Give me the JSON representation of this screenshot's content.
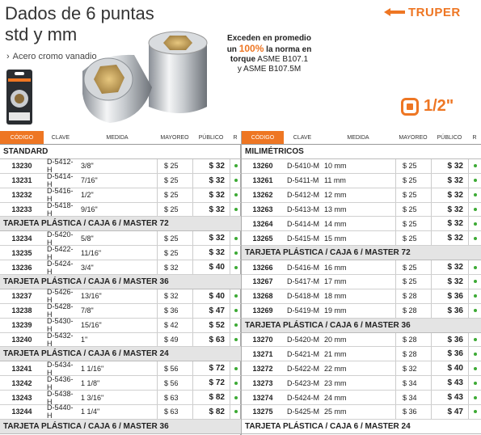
{
  "header": {
    "title": "Dados de 6 puntas std y mm",
    "subtitle": "Acero cromo vanadio",
    "brand": "TRUPER",
    "claim_line1": "Exceden en promedio",
    "claim_line2_pre": "un ",
    "claim_highlight": "100%",
    "claim_line2_post": " la norma en",
    "claim_line3_bold": "torque",
    "claim_line3_rest": " ASME B107.1",
    "claim_line4": "y ASME B107.5M",
    "drive_size": "1/2\"",
    "brand_color": "#ee7623"
  },
  "columns": [
    "CÓDIGO",
    "CLAVE",
    "MEDIDA",
    "MAYOREO",
    "PÚBLICO",
    "R"
  ],
  "left": [
    {
      "type": "section",
      "label": "STANDARD",
      "grey": false
    },
    {
      "type": "row",
      "codigo": "13230",
      "clave": "D-5412-H",
      "medida": "3/8\"",
      "mayoreo": "$ 25",
      "publico": "$ 32"
    },
    {
      "type": "row",
      "codigo": "13231",
      "clave": "D-5414-H",
      "medida": "7/16\"",
      "mayoreo": "$ 25",
      "publico": "$ 32"
    },
    {
      "type": "row",
      "codigo": "13232",
      "clave": "D-5416-H",
      "medida": "1/2\"",
      "mayoreo": "$ 25",
      "publico": "$ 32"
    },
    {
      "type": "row",
      "codigo": "13233",
      "clave": "D-5418-H",
      "medida": "9/16\"",
      "mayoreo": "$ 25",
      "publico": "$ 32"
    },
    {
      "type": "section",
      "label": "TARJETA PLÁSTICA / CAJA 6 / MASTER 72",
      "grey": true
    },
    {
      "type": "row",
      "codigo": "13234",
      "clave": "D-5420-H",
      "medida": "5/8\"",
      "mayoreo": "$ 25",
      "publico": "$ 32"
    },
    {
      "type": "row",
      "codigo": "13235",
      "clave": "D-5422-H",
      "medida": "11/16\"",
      "mayoreo": "$ 25",
      "publico": "$ 32"
    },
    {
      "type": "row",
      "codigo": "13236",
      "clave": "D-5424-H",
      "medida": "3/4\"",
      "mayoreo": "$ 32",
      "publico": "$ 40"
    },
    {
      "type": "section",
      "label": "TARJETA PLÁSTICA / CAJA 6 / MASTER 36",
      "grey": true
    },
    {
      "type": "row",
      "codigo": "13237",
      "clave": "D-5426-H",
      "medida": "13/16\"",
      "mayoreo": "$ 32",
      "publico": "$ 40"
    },
    {
      "type": "row",
      "codigo": "13238",
      "clave": "D-5428-H",
      "medida": "7/8\"",
      "mayoreo": "$ 36",
      "publico": "$ 47"
    },
    {
      "type": "row",
      "codigo": "13239",
      "clave": "D-5430-H",
      "medida": "15/16\"",
      "mayoreo": "$ 42",
      "publico": "$ 52"
    },
    {
      "type": "row",
      "codigo": "13240",
      "clave": "D-5432-H",
      "medida": "1\"",
      "mayoreo": "$ 49",
      "publico": "$ 63"
    },
    {
      "type": "section",
      "label": "TARJETA PLÁSTICA / CAJA 6 / MASTER 24",
      "grey": true
    },
    {
      "type": "row",
      "codigo": "13241",
      "clave": "D-5434-H",
      "medida": "1 1/16\"",
      "mayoreo": "$ 56",
      "publico": "$ 72"
    },
    {
      "type": "row",
      "codigo": "13242",
      "clave": "D-5436-H",
      "medida": "1 1/8\"",
      "mayoreo": "$ 56",
      "publico": "$ 72"
    },
    {
      "type": "row",
      "codigo": "13243",
      "clave": "D-5438-H",
      "medida": "1 3/16\"",
      "mayoreo": "$ 63",
      "publico": "$ 82"
    },
    {
      "type": "row",
      "codigo": "13244",
      "clave": "D-5440-H",
      "medida": "1 1/4\"",
      "mayoreo": "$ 63",
      "publico": "$ 82"
    },
    {
      "type": "section",
      "label": "TARJETA PLÁSTICA / CAJA 6 / MASTER 36",
      "grey": true
    }
  ],
  "right": [
    {
      "type": "section",
      "label": "MILIMÉTRICOS",
      "grey": false
    },
    {
      "type": "row",
      "codigo": "13260",
      "clave": "D-5410-M",
      "medida": "10 mm",
      "mayoreo": "$ 25",
      "publico": "$ 32"
    },
    {
      "type": "row",
      "codigo": "13261",
      "clave": "D-5411-M",
      "medida": "11 mm",
      "mayoreo": "$ 25",
      "publico": "$ 32"
    },
    {
      "type": "row",
      "codigo": "13262",
      "clave": "D-5412-M",
      "medida": "12 mm",
      "mayoreo": "$ 25",
      "publico": "$ 32"
    },
    {
      "type": "row",
      "codigo": "13263",
      "clave": "D-5413-M",
      "medida": "13 mm",
      "mayoreo": "$ 25",
      "publico": "$ 32"
    },
    {
      "type": "row",
      "codigo": "13264",
      "clave": "D-5414-M",
      "medida": "14 mm",
      "mayoreo": "$ 25",
      "publico": "$ 32"
    },
    {
      "type": "row",
      "codigo": "13265",
      "clave": "D-5415-M",
      "medida": "15 mm",
      "mayoreo": "$ 25",
      "publico": "$ 32"
    },
    {
      "type": "section",
      "label": "TARJETA PLÁSTICA / CAJA 6 / MASTER 72",
      "grey": true
    },
    {
      "type": "row",
      "codigo": "13266",
      "clave": "D-5416-M",
      "medida": "16 mm",
      "mayoreo": "$ 25",
      "publico": "$ 32"
    },
    {
      "type": "row",
      "codigo": "13267",
      "clave": "D-5417-M",
      "medida": "17 mm",
      "mayoreo": "$ 25",
      "publico": "$ 32"
    },
    {
      "type": "row",
      "codigo": "13268",
      "clave": "D-5418-M",
      "medida": "18 mm",
      "mayoreo": "$ 28",
      "publico": "$ 36"
    },
    {
      "type": "row",
      "codigo": "13269",
      "clave": "D-5419-M",
      "medida": "19 mm",
      "mayoreo": "$ 28",
      "publico": "$ 36"
    },
    {
      "type": "section",
      "label": "TARJETA PLÁSTICA / CAJA 6 / MASTER 36",
      "grey": true
    },
    {
      "type": "row",
      "codigo": "13270",
      "clave": "D-5420-M",
      "medida": "20 mm",
      "mayoreo": "$ 28",
      "publico": "$ 36"
    },
    {
      "type": "row",
      "codigo": "13271",
      "clave": "D-5421-M",
      "medida": "21 mm",
      "mayoreo": "$ 28",
      "publico": "$ 36"
    },
    {
      "type": "row",
      "codigo": "13272",
      "clave": "D-5422-M",
      "medida": "22 mm",
      "mayoreo": "$ 32",
      "publico": "$ 40"
    },
    {
      "type": "row",
      "codigo": "13273",
      "clave": "D-5423-M",
      "medida": "23 mm",
      "mayoreo": "$ 34",
      "publico": "$ 43"
    },
    {
      "type": "row",
      "codigo": "13274",
      "clave": "D-5424-M",
      "medida": "24 mm",
      "mayoreo": "$ 34",
      "publico": "$ 43"
    },
    {
      "type": "row",
      "codigo": "13275",
      "clave": "D-5425-M",
      "medida": "25 mm",
      "mayoreo": "$ 36",
      "publico": "$ 47"
    },
    {
      "type": "section",
      "label": "TARJETA PLÁSTICA / CAJA 6 / MASTER 24",
      "grey": false
    }
  ],
  "icons": {
    "availability": "green-dot-icon",
    "drive": "square-drive-icon",
    "brand_logo": "truper-logo-icon",
    "subtitle_bullet": "chevron-right-icon"
  },
  "status_color": "#3daa35"
}
